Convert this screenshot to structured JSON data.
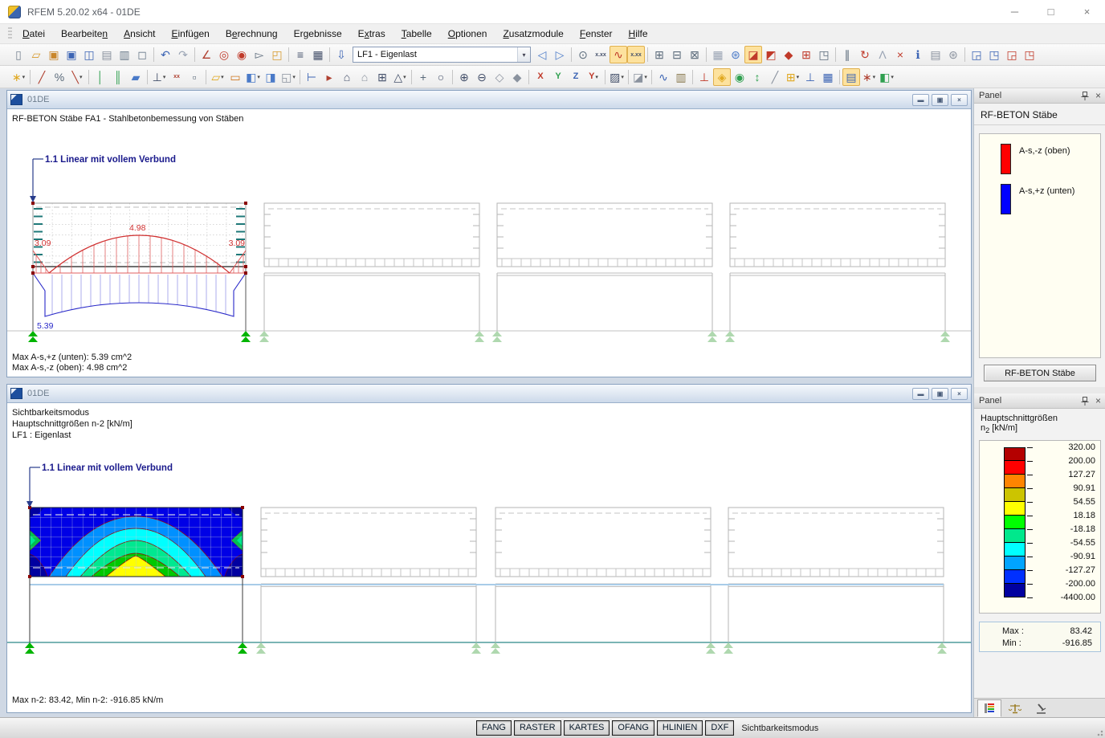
{
  "titlebar": {
    "title": "RFEM 5.20.02 x64 - 01DE",
    "controls": [
      {
        "n": "minimize-icon",
        "g": "─"
      },
      {
        "n": "maximize-icon",
        "g": "□"
      },
      {
        "n": "close-icon",
        "g": "×"
      }
    ]
  },
  "menu": {
    "items": [
      {
        "label": "Datei",
        "u": 0
      },
      {
        "label": "Bearbeiten",
        "u": 9
      },
      {
        "label": "Ansicht",
        "u": 0
      },
      {
        "label": "Einfügen",
        "u": 0
      },
      {
        "label": "Berechnung",
        "u": 1
      },
      {
        "label": "Ergebnisse",
        "u": 2
      },
      {
        "label": "Extras",
        "u": 1
      },
      {
        "label": "Tabelle",
        "u": 0
      },
      {
        "label": "Optionen",
        "u": 0
      },
      {
        "label": "Zusatzmodule",
        "u": 0
      },
      {
        "label": "Fenster",
        "u": 0
      },
      {
        "label": "Hilfe",
        "u": 0
      }
    ]
  },
  "toolbar1": {
    "combo_value": "LF1 - Eigenlast",
    "left": [
      {
        "n": "new-model",
        "g": "▯",
        "c": "#7a8694"
      },
      {
        "n": "open-model",
        "g": "▱",
        "c": "#d79b2e"
      },
      {
        "n": "open-project",
        "g": "▣",
        "c": "#c9862b"
      },
      {
        "n": "save-all",
        "g": "▣",
        "c": "#3c64b4"
      },
      {
        "n": "save",
        "g": "◫",
        "c": "#3c64b4"
      },
      {
        "n": "paste",
        "g": "▤",
        "c": "#8a929e"
      },
      {
        "n": "print",
        "g": "▥",
        "c": "#6a7a8a"
      },
      {
        "n": "print-preview",
        "g": "◻",
        "c": "#6a7a8a"
      },
      {
        "sep": true
      },
      {
        "n": "undo",
        "g": "↶",
        "c": "#3c64b4"
      },
      {
        "n": "redo",
        "g": "↷",
        "c": "#9aa4b4"
      },
      {
        "sep": true
      },
      {
        "n": "measure",
        "g": "∠",
        "c": "#b04030"
      },
      {
        "n": "snap-settings",
        "g": "◎",
        "c": "#c03a2a"
      },
      {
        "n": "center-view",
        "g": "◉",
        "c": "#c03a2a"
      },
      {
        "n": "pick-object",
        "g": "▻",
        "c": "#5a6a7a"
      },
      {
        "n": "new-window",
        "g": "◰",
        "c": "#d79b2e"
      },
      {
        "sep": true
      },
      {
        "n": "tables",
        "g": "≡",
        "c": "#44506a"
      },
      {
        "n": "table-grid",
        "g": "▦",
        "c": "#44506a"
      },
      {
        "sep": true
      },
      {
        "n": "load-case",
        "g": "⇩",
        "c": "#3c64b4"
      }
    ],
    "right": [
      {
        "n": "prev-load-case",
        "g": "◁",
        "c": "#4a7ac8"
      },
      {
        "n": "next-load-case",
        "g": "▷",
        "c": "#4a7ac8"
      },
      {
        "sep": true
      },
      {
        "n": "show-loads",
        "g": "⊙",
        "c": "#5a6a7a"
      },
      {
        "n": "show-load-values",
        "g": "x.xx",
        "c": "#44506a",
        "t": true
      },
      {
        "n": "show-results",
        "g": "∿",
        "c": "#c03a2a",
        "hl": true
      },
      {
        "n": "show-result-values",
        "g": "x.xx",
        "c": "#44506a",
        "t": true,
        "hl": true
      },
      {
        "sep": true
      },
      {
        "n": "print-graphic",
        "g": "⊞",
        "c": "#5a6a7a"
      },
      {
        "n": "graphic-printout",
        "g": "⊟",
        "c": "#5a6a7a"
      },
      {
        "n": "mass-printout",
        "g": "⊠",
        "c": "#5a6a7a"
      },
      {
        "sep": true
      },
      {
        "n": "fe-mesh",
        "g": "▦",
        "c": "#9aa4b4"
      },
      {
        "n": "fe-mesh-settings",
        "g": "⊛",
        "c": "#4a7ac8"
      },
      {
        "n": "section-active",
        "g": "◪",
        "c": "#c03a2a",
        "hl": true
      },
      {
        "n": "section-vertical",
        "g": "◩",
        "c": "#c03a2a"
      },
      {
        "n": "section-horizontal",
        "g": "◆",
        "c": "#c03a2a"
      },
      {
        "n": "section-grid",
        "g": "⊞",
        "c": "#c03a2a"
      },
      {
        "n": "clipping-plane",
        "g": "◳",
        "c": "#5a6a7a"
      },
      {
        "sep": true
      },
      {
        "n": "cut-section",
        "g": "∥",
        "c": "#5a6a7a"
      },
      {
        "n": "rotate-view",
        "g": "↻",
        "c": "#c03a2a"
      },
      {
        "n": "mirror-model",
        "g": "Λ",
        "c": "#9aa4b4"
      },
      {
        "n": "delete-results",
        "g": "×",
        "c": "#c03a2a"
      },
      {
        "n": "model-info",
        "g": "ℹ",
        "c": "#3c64b4"
      },
      {
        "n": "comment",
        "g": "▤",
        "c": "#8a929e"
      },
      {
        "n": "program-options",
        "g": "⊛",
        "c": "#8a929e"
      },
      {
        "sep": true
      },
      {
        "n": "import-graphic-1",
        "g": "◲",
        "c": "#3c64b4"
      },
      {
        "n": "import-graphic-2",
        "g": "◳",
        "c": "#3c64b4"
      },
      {
        "n": "export-graphic-1",
        "g": "◲",
        "c": "#c03a2a"
      },
      {
        "n": "export-graphic-2",
        "g": "◳",
        "c": "#c03a2a"
      }
    ]
  },
  "toolbar2": {
    "items": [
      {
        "n": "new-node",
        "g": "∗",
        "c": "#e0a820",
        "dd": true
      },
      {
        "sep": true
      },
      {
        "n": "new-line",
        "g": "╱",
        "c": "#b04030"
      },
      {
        "n": "divide-line",
        "g": "%",
        "c": "#5a6a7a"
      },
      {
        "n": "new-polyline",
        "g": "╲",
        "c": "#b04030",
        "dd": true
      },
      {
        "sep": true
      },
      {
        "n": "new-member",
        "g": "│",
        "c": "#30a050"
      },
      {
        "n": "new-member-set",
        "g": "║",
        "c": "#30a050"
      },
      {
        "n": "new-surface",
        "g": "▰",
        "c": "#4a7ac8"
      },
      {
        "sep": true
      },
      {
        "n": "new-support",
        "g": "⊥",
        "c": "#44506a",
        "dd": true
      },
      {
        "n": "new-hinge",
        "g": "xx",
        "c": "#b04030",
        "t": true
      },
      {
        "n": "mesh-refinement",
        "g": "▫",
        "c": "#5a6a7a"
      },
      {
        "sep": true
      },
      {
        "n": "select-surface",
        "g": "▱",
        "c": "#e0a820",
        "dd": true
      },
      {
        "n": "new-opening",
        "g": "▭",
        "c": "#d07820"
      },
      {
        "n": "new-solid",
        "g": "◧",
        "c": "#4a7ac8",
        "dd": true
      },
      {
        "n": "new-solid-node",
        "g": "◨",
        "c": "#4a7ac8"
      },
      {
        "n": "copy-objects",
        "g": "◱",
        "c": "#8a929e",
        "dd": true
      },
      {
        "sep": true
      },
      {
        "n": "connect-members",
        "g": "⊢",
        "c": "#3c64b4"
      },
      {
        "n": "generate-model",
        "g": "▸",
        "c": "#b04030"
      },
      {
        "n": "generate-frame-2d",
        "g": "⌂",
        "c": "#44506a"
      },
      {
        "n": "generate-frame-3d",
        "g": "⌂",
        "c": "#8a929e"
      },
      {
        "n": "generate-grid",
        "g": "⊞",
        "c": "#44506a"
      },
      {
        "n": "generate-roof",
        "g": "△",
        "c": "#44506a",
        "dd": true
      },
      {
        "sep": true
      },
      {
        "n": "special-selection",
        "g": "+",
        "c": "#5a6a7a"
      },
      {
        "n": "zoom-region",
        "g": "○",
        "c": "#44506a"
      },
      {
        "sep": true
      },
      {
        "n": "zoom-in",
        "g": "⊕",
        "c": "#44506a"
      },
      {
        "n": "zoom-out",
        "g": "⊖",
        "c": "#44506a"
      },
      {
        "n": "isometric-view",
        "g": "◇",
        "c": "#8a929e"
      },
      {
        "n": "previous-view",
        "g": "◆",
        "c": "#8a929e"
      },
      {
        "sep": true
      },
      {
        "n": "view-in-x",
        "g": "X",
        "c": "#c03a2a",
        "t2": true
      },
      {
        "n": "view-in-y",
        "g": "Y",
        "c": "#30a050",
        "t2": true
      },
      {
        "n": "view-in-z",
        "g": "Z",
        "c": "#3c64b4",
        "t2": true
      },
      {
        "n": "view-in-minus-y",
        "g": "Y",
        "c": "#c03a2a",
        "t2": true,
        "dd": true
      },
      {
        "sep": true
      },
      {
        "n": "work-plane",
        "g": "▨",
        "c": "#44506a",
        "dd": true
      },
      {
        "sep": true
      },
      {
        "n": "display-properties",
        "g": "◪",
        "c": "#8a929e",
        "dd": true
      },
      {
        "sep": true
      },
      {
        "n": "member-diagrams",
        "g": "∿",
        "c": "#3c64b4"
      },
      {
        "n": "printout-report",
        "g": "▥",
        "c": "#8a7a50"
      },
      {
        "sep": true
      },
      {
        "n": "axes-display",
        "g": "⊥",
        "c": "#c03a2a"
      },
      {
        "n": "results-contour",
        "g": "◈",
        "c": "#e0a820",
        "hl": true
      },
      {
        "n": "results-on-surfaces",
        "g": "◉",
        "c": "#30a050"
      },
      {
        "n": "shrink-members",
        "g": "↕",
        "c": "#30a050"
      },
      {
        "n": "smooth-results",
        "g": "╱",
        "c": "#8a929e"
      },
      {
        "n": "window-layout",
        "g": "⊞",
        "c": "#e0a820",
        "dd": true
      },
      {
        "n": "new-section",
        "g": "⊥",
        "c": "#3c64b4"
      },
      {
        "n": "result-tables",
        "g": "▦",
        "c": "#3c64b4"
      },
      {
        "sep": true
      },
      {
        "n": "panel-toggle",
        "g": "▤",
        "c": "#3c64b4",
        "hl": true
      },
      {
        "n": "display-settings",
        "g": "∗",
        "c": "#b04030",
        "dd": true
      },
      {
        "n": "color-scale",
        "g": "◧",
        "c": "#30a050",
        "dd": true
      }
    ]
  },
  "w1": {
    "title": "01DE",
    "heading": "RF-BETON Stäbe FA1 - Stahlbetonbemessung von Stäben",
    "beam_label": "1.1 Linear mit vollem Verbund",
    "value_top_mid": "4.98",
    "value_top_left": "3.09",
    "value_top_right": "3.09",
    "value_bottom": "5.39",
    "footer_line1": "Max A-s,+z (unten): 5.39 cm^2",
    "footer_line2": "Max A-s,-z (oben): 4.98 cm^2",
    "controls": [
      {
        "n": "minimize-icon",
        "g": "▬"
      },
      {
        "n": "restore-icon",
        "g": "▣"
      },
      {
        "n": "close-icon",
        "g": "×"
      }
    ]
  },
  "w2": {
    "title": "01DE",
    "heading_line1": "Sichtbarkeitsmodus",
    "heading_line2": "Hauptschnittgrößen n-2 [kN/m]",
    "heading_line3": "LF1 : Eigenlast",
    "beam_label": "1.1 Linear mit vollem Verbund",
    "footer": "Max n-2: 83.42, Min n-2: -916.85 kN/m",
    "controls": [
      {
        "n": "minimize-icon",
        "g": "▬"
      },
      {
        "n": "restore-icon",
        "g": "▣"
      },
      {
        "n": "close-icon",
        "g": "×"
      }
    ]
  },
  "panelA": {
    "header": "Panel",
    "title": "RF-BETON Stäbe",
    "legend": [
      {
        "color": "#FF0000",
        "label": "A-s,-z (oben)"
      },
      {
        "color": "#0000FF",
        "label": "A-s,+z (unten)"
      }
    ],
    "button": "RF-BETON Stäbe"
  },
  "panelB": {
    "header": "Panel",
    "title": "Hauptschnittgrößen",
    "unit_n": "n",
    "unit_sub": "2",
    "unit_rest": " [kN/m]",
    "scale": {
      "colors": [
        "#B40000",
        "#FF0000",
        "#FF8400",
        "#CCC400",
        "#FFFF00",
        "#00FF00",
        "#00E88C",
        "#00FFFF",
        "#00A4FF",
        "#0030FF",
        "#0000A0"
      ],
      "labels": [
        "320.00",
        "200.00",
        "127.27",
        "90.91",
        "54.55",
        "18.18",
        "-18.18",
        "-54.55",
        "-90.91",
        "-127.27",
        "-200.00",
        "-4400.00"
      ]
    },
    "max_label": "Max :",
    "max_value": "83.42",
    "min_label": "Min :",
    "min_value": "-916.85"
  },
  "statusbar": {
    "buttons": [
      "FANG",
      "RASTER",
      "KARTES",
      "OFANG",
      "HLINIEN",
      "DXF"
    ],
    "mode": "Sichtbarkeitsmodus"
  }
}
